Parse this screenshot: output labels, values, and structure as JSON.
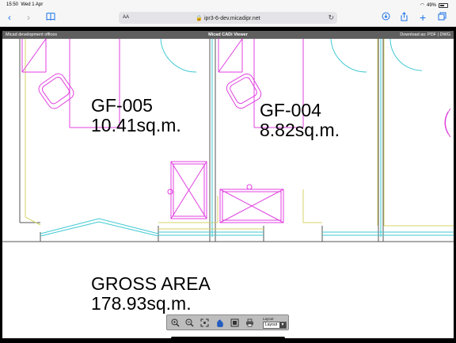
{
  "status_bar": {
    "time": "15:50",
    "date": "Wed 1 Apr",
    "battery": "49%"
  },
  "safari": {
    "text_size": "AA",
    "url": "ipr3-6-dev.micadipr.net",
    "icons": [
      "chevron-left-icon",
      "chevron-right-icon",
      "book-icon",
      "lock-icon",
      "reload-icon",
      "download-icon",
      "share-icon",
      "plus-icon",
      "tabs-icon"
    ]
  },
  "viewer_bar": {
    "org": "Micad development offices",
    "title": "Micad CADi Viewer",
    "download_prefix": "Download as:",
    "pdf": "PDF",
    "dwg": "DWG"
  },
  "rooms": [
    {
      "code": "GF-005",
      "area": "10.41sq.m."
    },
    {
      "code": "GF-004",
      "area": "8.82sq.m."
    }
  ],
  "gross": {
    "label": "GROSS AREA",
    "area": "178.93sq.m."
  },
  "toolbar": {
    "tools": [
      "zoom-in-icon",
      "zoom-out-icon",
      "zoom-extents-icon",
      "pan-hand-icon",
      "zoom-window-icon",
      "print-icon"
    ],
    "layout_label": "Layout",
    "layout_value": "Layout"
  },
  "colors": {
    "cyan": "#3fc9d3",
    "magenta": "#e040e0",
    "yellow": "#d6d66a",
    "dark_line": "#555555"
  }
}
